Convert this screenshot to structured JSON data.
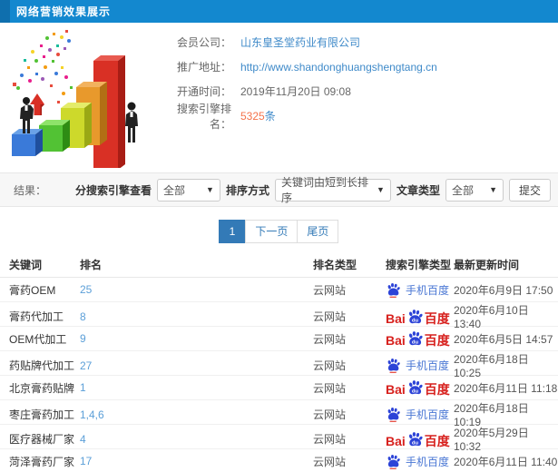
{
  "header": {
    "title": "网络营销效果展示"
  },
  "info": {
    "fields": [
      {
        "label": "会员公司：",
        "value": "山东皇圣堂药业有限公司"
      },
      {
        "label": "推广地址：",
        "value": "http://www.shandonghuangshengtang.cn"
      },
      {
        "label": "开通时间：",
        "value": "2019年11月20日 09:08"
      },
      {
        "label": "搜索引擎排名：",
        "value": "5325",
        "suffix": "条"
      }
    ]
  },
  "filters": {
    "result_label": "结果：",
    "engine_label": "分搜索引擎查看",
    "engine_value": "全部",
    "sort_label": "排序方式",
    "sort_value": "关键词由短到长排序",
    "article_label": "文章类型",
    "article_value": "全部",
    "submit_label": "提交",
    "caret": "▼"
  },
  "pagination": {
    "current": "1",
    "next": "下一页",
    "last": "尾页"
  },
  "table": {
    "headers": [
      "关键词",
      "排名",
      "排名类型",
      "搜索引擎类型",
      "最新更新时间"
    ],
    "engine_assets": {
      "baidu": {
        "pre": "Bai",
        "mid": "du",
        "post": "百度"
      },
      "mobile": {
        "label": "手机百度"
      }
    },
    "rows": [
      {
        "keyword": "膏药OEM",
        "rank": "25",
        "rank_type": "云网站",
        "engine": "mobile-baidu",
        "updated": "2020年6月9日 17:50"
      },
      {
        "keyword": "膏药代加工",
        "rank": "8",
        "rank_type": "云网站",
        "engine": "baidu",
        "updated": "2020年6月10日 13:40"
      },
      {
        "keyword": "OEM代加工",
        "rank": "9",
        "rank_type": "云网站",
        "engine": "baidu",
        "updated": "2020年6月5日 14:57"
      },
      {
        "keyword": "药贴牌代加工",
        "rank": "27",
        "rank_type": "云网站",
        "engine": "mobile-baidu",
        "updated": "2020年6月18日 10:25"
      },
      {
        "keyword": "北京膏药贴牌",
        "rank": "1",
        "rank_type": "云网站",
        "engine": "baidu",
        "updated": "2020年6月11日 11:18"
      },
      {
        "keyword": "枣庄膏药加工",
        "rank": "1,4,6",
        "rank_type": "云网站",
        "engine": "mobile-baidu",
        "updated": "2020年6月18日 10:19"
      },
      {
        "keyword": "医疗器械厂家",
        "rank": "4",
        "rank_type": "云网站",
        "engine": "baidu",
        "updated": "2020年5月29日 10:32"
      },
      {
        "keyword": "菏泽膏药厂家",
        "rank": "17",
        "rank_type": "云网站",
        "engine": "mobile-baidu",
        "updated": "2020年6月11日 11:40"
      }
    ]
  },
  "colors": {
    "header_bg": "#1388cf",
    "link": "#3f8ac9",
    "rank_link": "#5b9fd8",
    "highlight": "#f4724a",
    "active_page": "#337ab7",
    "baidu_red": "#d7201d",
    "baidu_blue": "#2c43d7",
    "mobile_baidu_text": "#4a77d4"
  }
}
